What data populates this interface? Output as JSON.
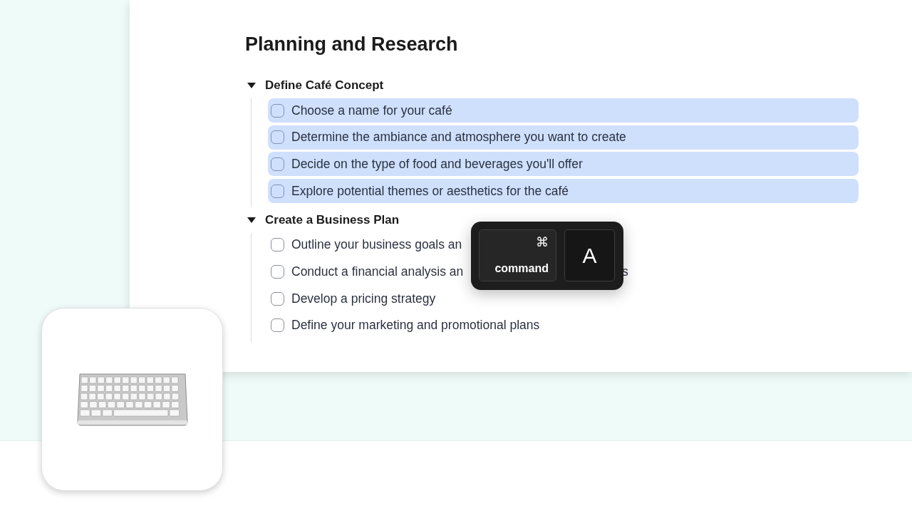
{
  "heading": "Planning and Research",
  "sections": [
    {
      "title": "Define Café Concept",
      "expanded": true,
      "tasks": [
        {
          "text": "Choose a name for your café",
          "checked": false,
          "selected": true
        },
        {
          "text": "Determine the ambiance and atmosphere you want to create",
          "checked": false,
          "selected": true
        },
        {
          "text": "Decide on the type of food and beverages you'll offer",
          "checked": false,
          "selected": true
        },
        {
          "text": "Explore potential themes or aesthetics for the café",
          "checked": false,
          "selected": true
        }
      ]
    },
    {
      "title": "Create a Business Plan",
      "expanded": true,
      "tasks": [
        {
          "text": "Outline your business goals an",
          "checked": false,
          "selected": false
        },
        {
          "text": "Conduct a financial analysis an",
          "tail": "s",
          "checked": false,
          "selected": false
        },
        {
          "text": "Develop a pricing strategy",
          "checked": false,
          "selected": false
        },
        {
          "text": "Define your marketing and promotional plans",
          "checked": false,
          "selected": false
        }
      ]
    }
  ],
  "shortcut": {
    "keys": [
      {
        "kind": "modifier",
        "symbol": "⌘",
        "label": "command"
      },
      {
        "kind": "letter",
        "label": "A"
      }
    ]
  }
}
